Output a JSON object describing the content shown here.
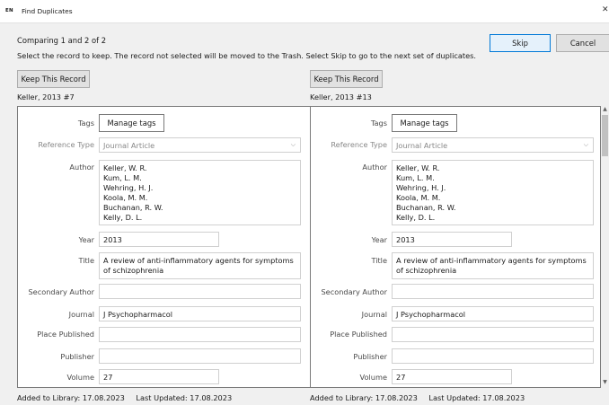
{
  "window": {
    "icon": "EN",
    "title": "Find Duplicates"
  },
  "header": {
    "comparing": "Comparing 1 and 2 of 2",
    "instructions": "Select the record to keep. The record not selected will be moved to the Trash. Select Skip to go to the next set of duplicates."
  },
  "buttons": {
    "skip": "Skip",
    "cancel": "Cancel",
    "keep": "Keep This Record",
    "manage_tags": "Manage tags"
  },
  "labels": {
    "tags": "Tags",
    "reference_type": "Reference Type",
    "author": "Author",
    "year": "Year",
    "title": "Title",
    "secondary_author": "Secondary Author",
    "journal": "Journal",
    "place_published": "Place Published",
    "publisher": "Publisher",
    "volume": "Volume",
    "added": "Added to Library:",
    "updated": "Last Updated:"
  },
  "left": {
    "record": "Keller, 2013 #7",
    "reference_type": "Journal Article",
    "authors": [
      "Keller, W. R.",
      "Kum, L. M.",
      "Wehring, H. J.",
      "Koola, M. M.",
      "Buchanan, R. W.",
      "Kelly, D. L."
    ],
    "year": "2013",
    "title": "A review of anti-inflammatory agents for symptoms of schizophrenia",
    "secondary_author": "",
    "journal": "J Psychopharmacol",
    "place_published": "",
    "publisher": "",
    "volume": "27",
    "added": "17.08.2023",
    "updated": "17.08.2023"
  },
  "right": {
    "record": "Keller, 2013 #13",
    "reference_type": "Journal Article",
    "authors": [
      "Keller, W. R.",
      "Kum, L. M.",
      "Wehring, H. J.",
      "Koola, M. M.",
      "Buchanan, R. W.",
      "Kelly, D. L."
    ],
    "year": "2013",
    "title": "A review of anti-inflammatory agents for symptoms of schizophrenia",
    "secondary_author": "",
    "journal": "J Psychopharmacol",
    "place_published": "",
    "publisher": "",
    "volume": "27",
    "added": "17.08.2023",
    "updated": "17.08.2023"
  },
  "icons": {
    "close": "close-icon",
    "dropdown": "chevron-down-icon",
    "scroll_up": "scroll-up-icon",
    "scroll_down": "scroll-down-icon"
  }
}
